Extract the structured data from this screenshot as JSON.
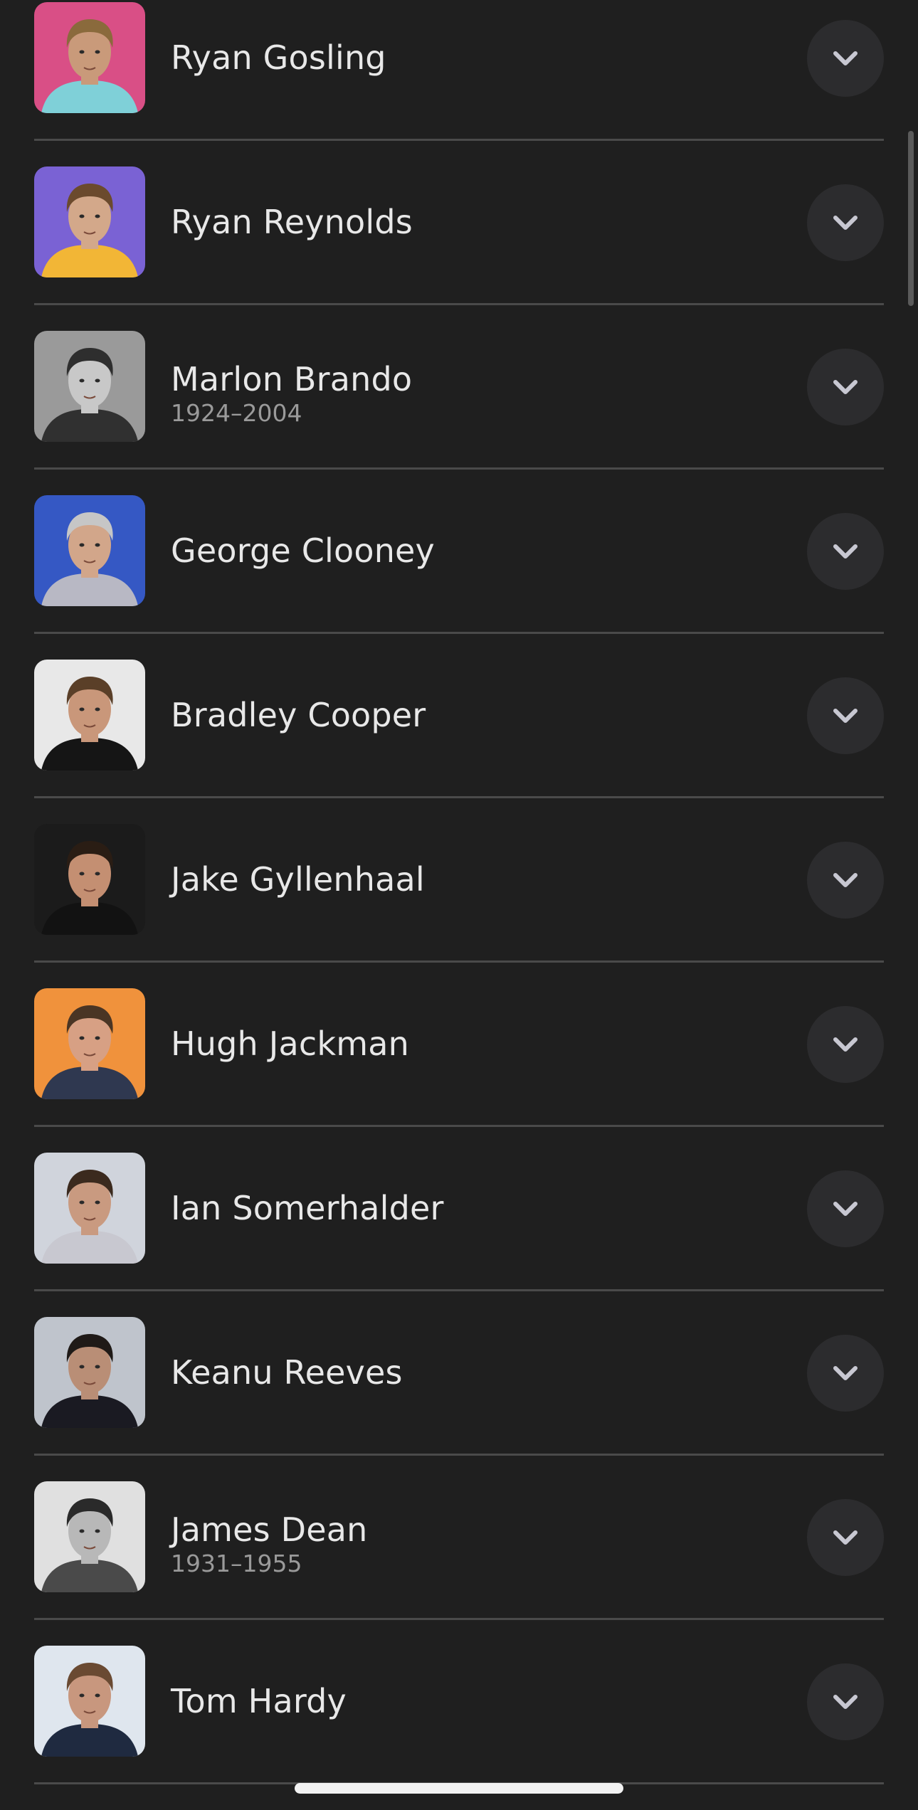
{
  "people": [
    {
      "name": "Ryan Gosling",
      "years": "",
      "avatar": {
        "bg": "#d94f86",
        "skin": "#c99a7a",
        "hair": "#8a6a3c",
        "shirt": "#7fd0d8"
      }
    },
    {
      "name": "Ryan Reynolds",
      "years": "",
      "avatar": {
        "bg": "#7a62d4",
        "skin": "#d3a88a",
        "hair": "#6b4a2d",
        "shirt": "#f2b636"
      }
    },
    {
      "name": "Marlon Brando",
      "years": "1924–2004",
      "avatar": {
        "bg": "#9a9a9a",
        "skin": "#c8c8c8",
        "hair": "#2e2e2e",
        "shirt": "#303030"
      }
    },
    {
      "name": "George Clooney",
      "years": "",
      "avatar": {
        "bg": "#3558c4",
        "skin": "#d2a68a",
        "hair": "#c6c6c6",
        "shirt": "#b8b8c4"
      }
    },
    {
      "name": "Bradley Cooper",
      "years": "",
      "avatar": {
        "bg": "#e8e8e8",
        "skin": "#c9977a",
        "hair": "#5a3f28",
        "shirt": "#151515"
      }
    },
    {
      "name": "Jake Gyllenhaal",
      "years": "",
      "avatar": {
        "bg": "#1b1b1b",
        "skin": "#c48f72",
        "hair": "#2a1d14",
        "shirt": "#121212"
      }
    },
    {
      "name": "Hugh Jackman",
      "years": "",
      "avatar": {
        "bg": "#f0923c",
        "skin": "#d7a084",
        "hair": "#4a3524",
        "shirt": "#2f3850"
      }
    },
    {
      "name": "Ian Somerhalder",
      "years": "",
      "avatar": {
        "bg": "#d0d4dc",
        "skin": "#c99a80",
        "hair": "#3b2a1e",
        "shirt": "#c8c8d0"
      }
    },
    {
      "name": "Keanu Reeves",
      "years": "",
      "avatar": {
        "bg": "#bfc4cc",
        "skin": "#b98e76",
        "hair": "#1f1a17",
        "shirt": "#1a1a22"
      }
    },
    {
      "name": "James Dean",
      "years": "1931–1955",
      "avatar": {
        "bg": "#e0e0e0",
        "skin": "#b8b8b8",
        "hair": "#2a2a2a",
        "shirt": "#4a4a4a"
      }
    },
    {
      "name": "Tom Hardy",
      "years": "",
      "avatar": {
        "bg": "#dfe6ee",
        "skin": "#c8977e",
        "hair": "#6a4a32",
        "shirt": "#1f2a40"
      }
    }
  ],
  "colors": {
    "background": "#1f1f1f",
    "divider": "#4a4a4a",
    "name_text": "#e8e8e8",
    "years_text": "#9a9a9a",
    "expand_button_bg": "#2c2c2e",
    "chevron": "#c8c8d2"
  },
  "icons": {
    "expand": "chevron-down-icon"
  }
}
